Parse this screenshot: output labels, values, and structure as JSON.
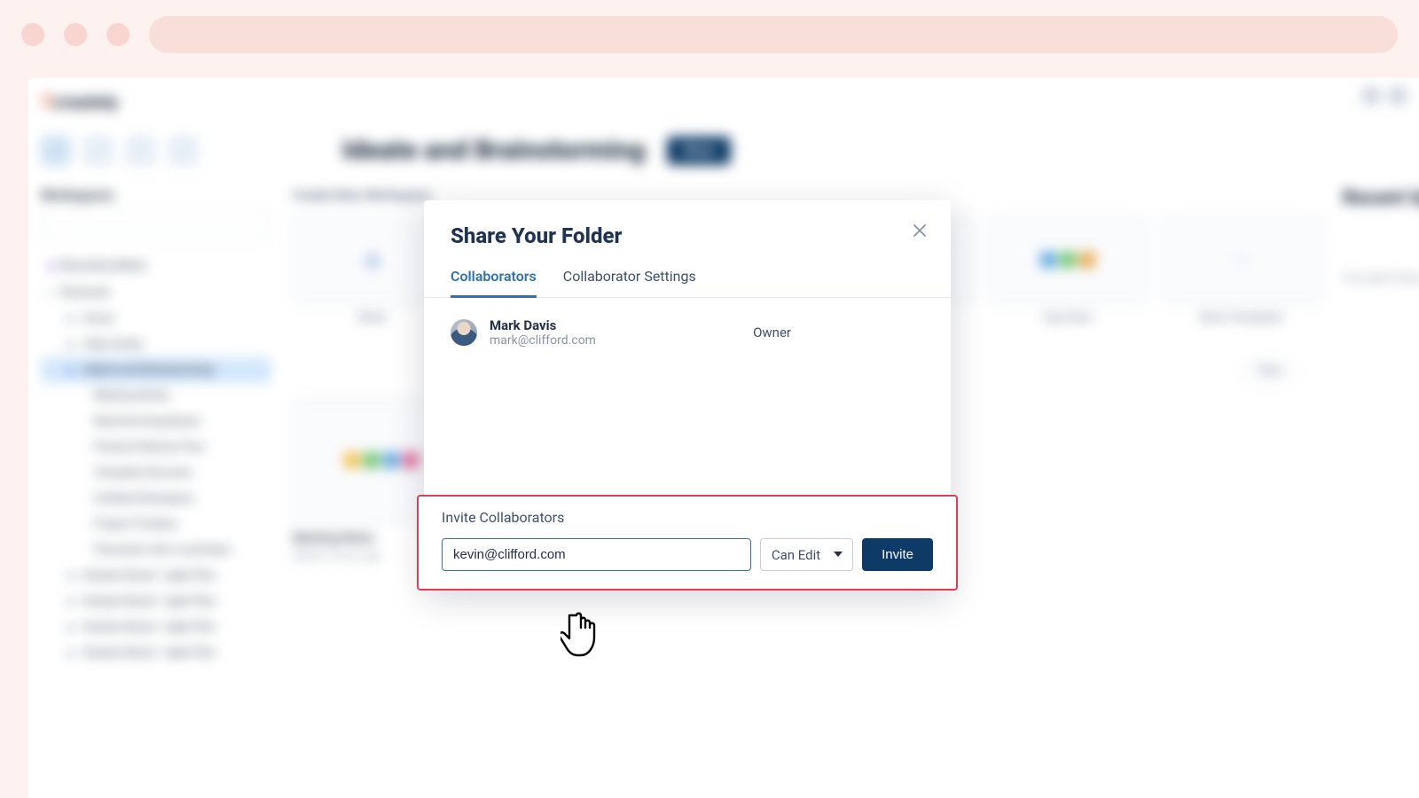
{
  "browser": {
    "dot_count": 3
  },
  "app": {
    "logo_text": "creately",
    "page_title": "Ideate and Brainstorming",
    "share_button": "Share",
    "workspaces_heading": "Workspaces",
    "search_placeholder": "Search here"
  },
  "sidebar": {
    "items": [
      {
        "label": "Recently Edited"
      },
      {
        "label": "Personal"
      },
      {
        "label": "Home"
      },
      {
        "label": "Help Center"
      },
      {
        "label": "Ideate and Brainstorming"
      },
      {
        "label": "Meeting Notes"
      },
      {
        "label": "Brainstorming Board"
      },
      {
        "label": "Product Delivery Flow"
      },
      {
        "label": "Template Structure"
      },
      {
        "label": "Untitled Workspace"
      },
      {
        "label": "Project Timeline"
      },
      {
        "label": "Flowchart with a swimlane"
      },
      {
        "label": "Kanban Board - Agile Plan"
      },
      {
        "label": "Kanban Board - Agile Plan"
      },
      {
        "label": "Kanban Board - Agile Plan"
      },
      {
        "label": "Kanban Board - Agile Plan"
      }
    ]
  },
  "main": {
    "create_heading": "Create New Workspace",
    "cards": [
      {
        "label": "Blank"
      },
      {
        "label": ""
      },
      {
        "label": ""
      },
      {
        "label": ""
      },
      {
        "label": "Org Chart"
      },
      {
        "label": "More Templates"
      }
    ],
    "filter_chip": "Files",
    "right_heading": "Recent Updates",
    "right_empty": "You don't have any notifications",
    "item1_title": "Meeting Notes",
    "item1_sub": "Edited 2 hours ago"
  },
  "modal": {
    "title": "Share Your Folder",
    "tabs": [
      {
        "label": "Collaborators",
        "active": true
      },
      {
        "label": "Collaborator Settings",
        "active": false
      }
    ],
    "collaborators": [
      {
        "name": "Mark Davis",
        "email": "mark@clifford.com",
        "role": "Owner"
      }
    ],
    "invite": {
      "heading": "Invite Collaborators",
      "input_value": "kevin@clifford.com",
      "permission": "Can Edit",
      "button": "Invite"
    }
  }
}
